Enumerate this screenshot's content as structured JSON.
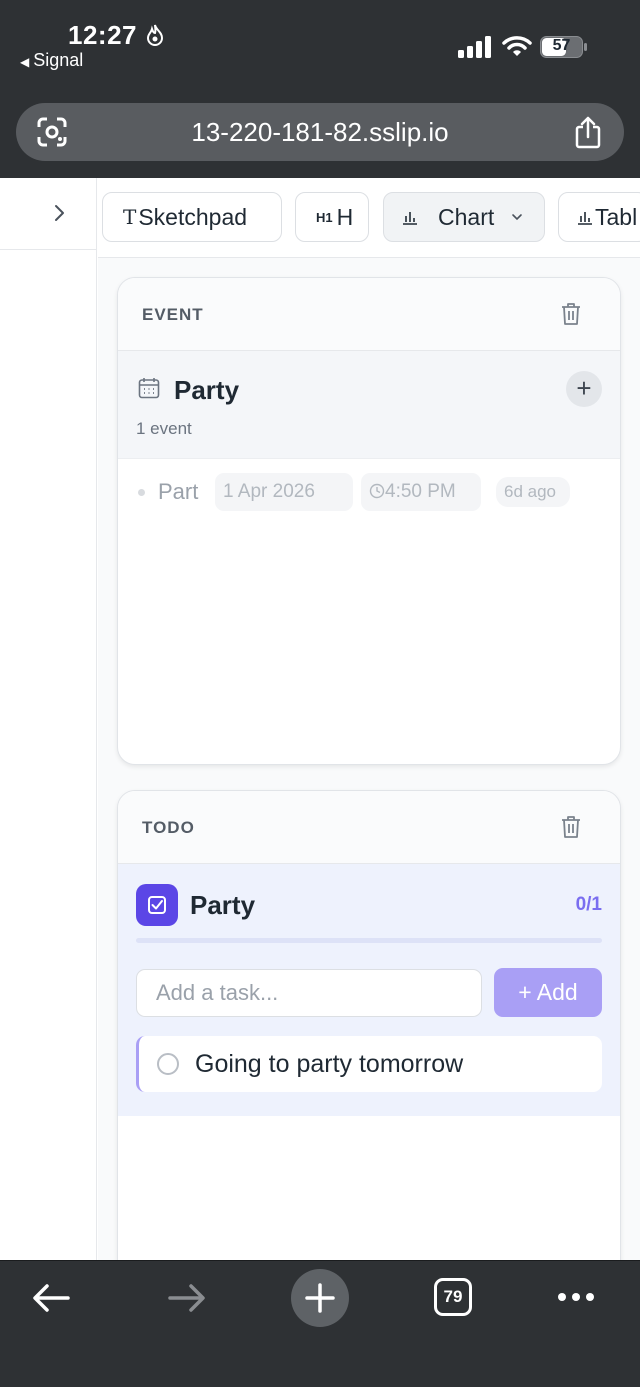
{
  "status_bar": {
    "time": "12:27",
    "back_app": "Signal",
    "battery": "57"
  },
  "browser": {
    "url": "13-220-181-82.sslip.io",
    "tab_count": "79"
  },
  "toolbar": {
    "items": [
      {
        "glyph": "T",
        "label": "Sketchpad"
      },
      {
        "glyph": "H1",
        "label": "H"
      },
      {
        "label": "Chart"
      },
      {
        "label": "Tabl"
      }
    ]
  },
  "event_card": {
    "kind": "EVENT",
    "title": "Party",
    "subtitle": "1 event",
    "add_symbol": "+",
    "event": {
      "name": "Part",
      "date": "1 Apr 2026",
      "time": "4:50 PM",
      "relative": "6d ago"
    }
  },
  "todo_card": {
    "kind": "TODO",
    "title": "Party",
    "count": "0/1",
    "progress": 0,
    "input_placeholder": "Add a task...",
    "add_label": "+ Add",
    "tasks": [
      {
        "text": "Going to party tomorrow",
        "done": false
      }
    ]
  },
  "colors": {
    "accent": "#5b46e6",
    "accent_light": "#a99ff5",
    "chrome": "#2e3134"
  }
}
